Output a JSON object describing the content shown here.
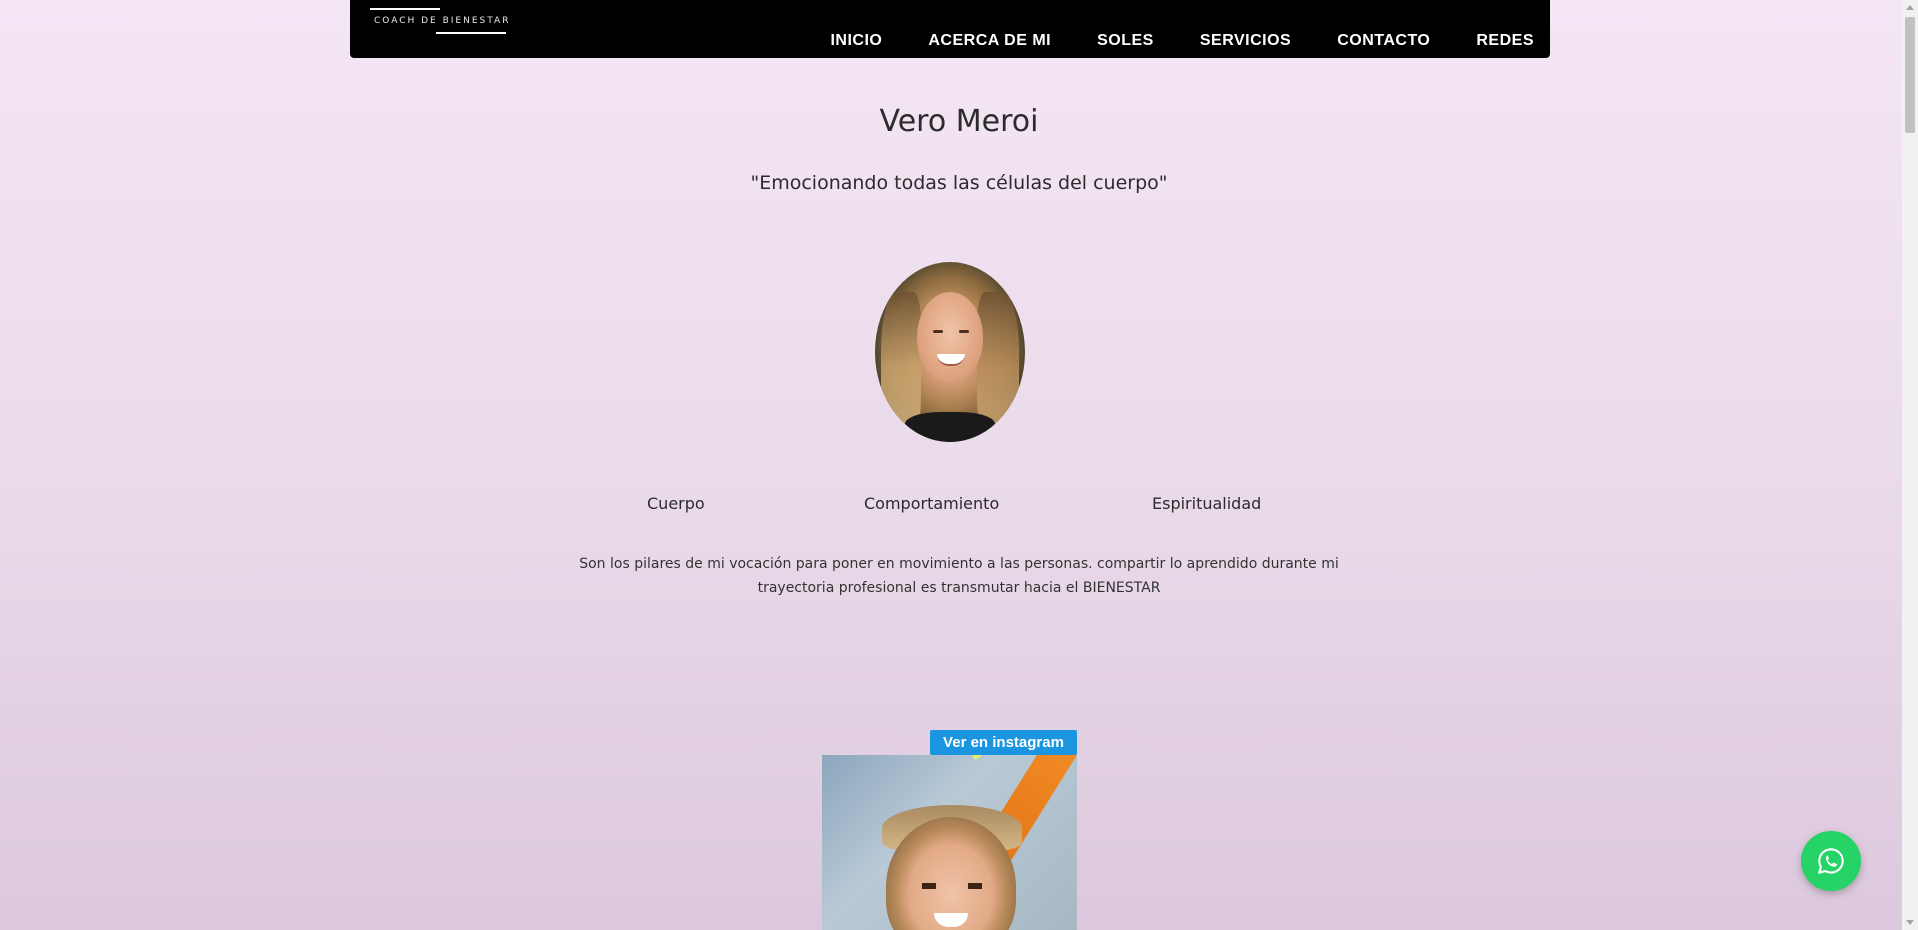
{
  "nav": {
    "logo_text": "COACH DE BIENESTAR",
    "items": [
      {
        "label": "INICIO"
      },
      {
        "label": "ACERCA DE MI"
      },
      {
        "label": "SOLES"
      },
      {
        "label": "SERVICIOS"
      },
      {
        "label": "CONTACTO"
      },
      {
        "label": "REDES"
      }
    ]
  },
  "hero": {
    "name": "Vero Meroi",
    "tagline": "\"Emocionando todas las células del cuerpo\""
  },
  "pillars": [
    {
      "label": "Cuerpo"
    },
    {
      "label": "Comportamiento"
    },
    {
      "label": "Espiritualidad"
    }
  ],
  "description": "Son los pilares de mi vocación para poner en movimiento a las personas. compartir lo aprendido durante mi trayectoria profesional es transmutar hacia el BIENESTAR",
  "instagram": {
    "button_label": "Ver en instagram"
  },
  "icons": {
    "whatsapp": "whatsapp-icon"
  },
  "colors": {
    "nav_background": "#000000",
    "instagram_button": "#1b95e0",
    "whatsapp": "#25d366"
  }
}
